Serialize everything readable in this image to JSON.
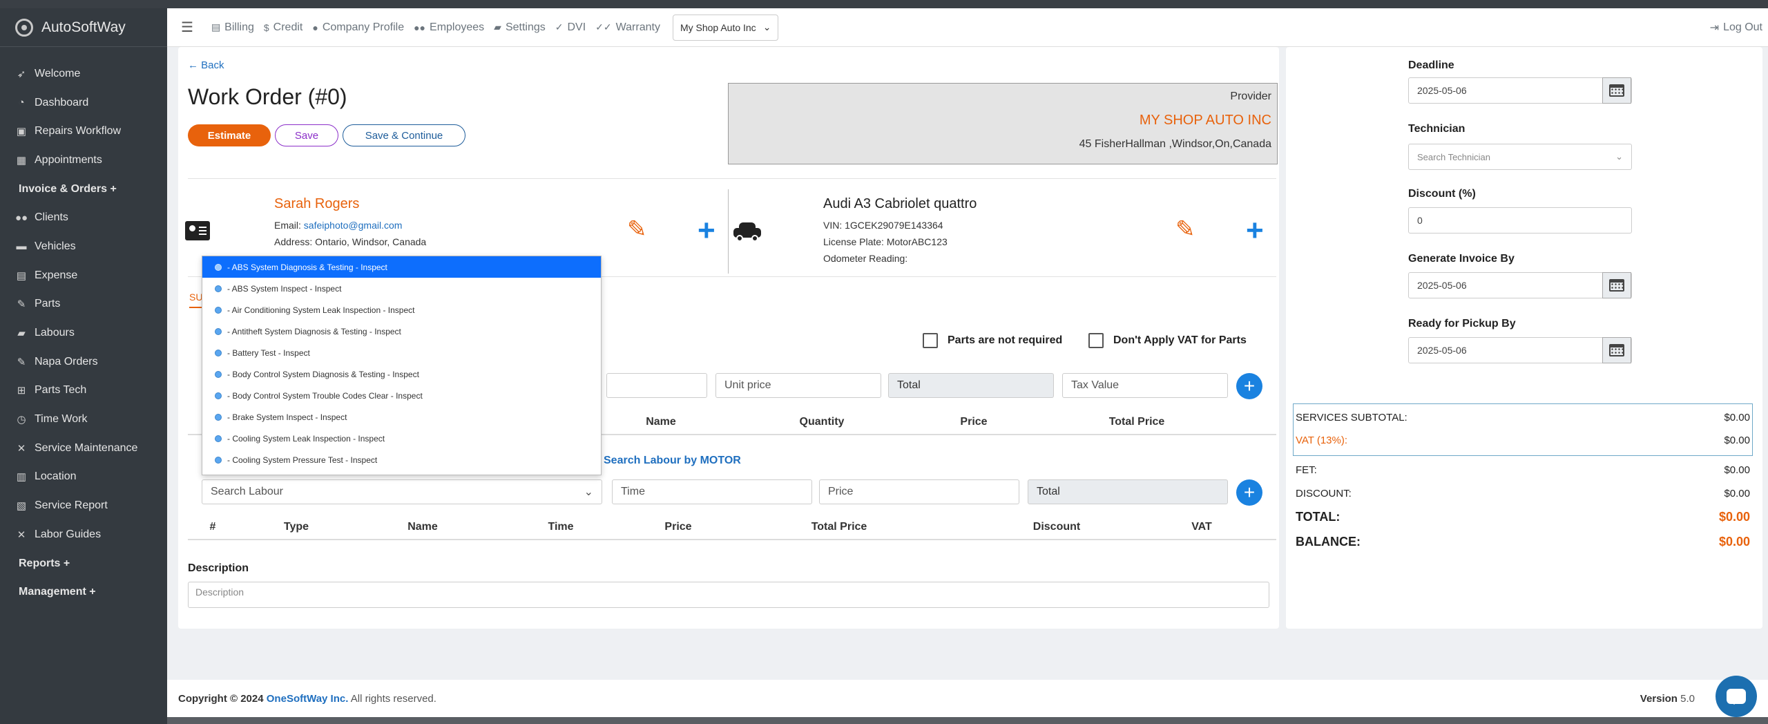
{
  "app": {
    "name": "AutoSoftWay"
  },
  "sidebar": {
    "items": [
      {
        "label": "Welcome",
        "icon": "rocket-icon"
      },
      {
        "label": "Dashboard",
        "icon": "dashboard-icon"
      },
      {
        "label": "Repairs Workflow",
        "icon": "workflow-icon"
      },
      {
        "label": "Appointments",
        "icon": "calendar-icon"
      },
      {
        "label": "Invoice & Orders +",
        "icon": ""
      },
      {
        "label": "Clients",
        "icon": "users-icon"
      },
      {
        "label": "Vehicles",
        "icon": "car-icon"
      },
      {
        "label": "Expense",
        "icon": "money-icon"
      },
      {
        "label": "Parts",
        "icon": "wrench-icon"
      },
      {
        "label": "Labours",
        "icon": "briefcase-icon"
      },
      {
        "label": "Napa Orders",
        "icon": "wrench-icon"
      },
      {
        "label": "Parts Tech",
        "icon": "sitemap-icon"
      },
      {
        "label": "Time Work",
        "icon": "clock-icon"
      },
      {
        "label": "Service Maintenance",
        "icon": "tools-icon"
      },
      {
        "label": "Location",
        "icon": "map-icon"
      },
      {
        "label": "Service Report",
        "icon": "report-icon"
      },
      {
        "label": "Labor Guides",
        "icon": "tools-icon"
      },
      {
        "label": "Reports +",
        "icon": ""
      },
      {
        "label": "Management +",
        "icon": ""
      }
    ]
  },
  "topbar": {
    "items": [
      {
        "label": "Billing",
        "icon": "billing-icon"
      },
      {
        "label": "Credit",
        "icon": "dollar-icon"
      },
      {
        "label": "Company Profile",
        "icon": "user-icon"
      },
      {
        "label": "Employees",
        "icon": "users-icon"
      },
      {
        "label": "Settings",
        "icon": "briefcase-icon"
      },
      {
        "label": "DVI",
        "icon": "check-icon"
      },
      {
        "label": "Warranty",
        "icon": "check-double-icon"
      }
    ],
    "shop_select": "My Shop Auto Inc",
    "logout": "Log Out"
  },
  "work_order": {
    "back": "Back",
    "title": "Work Order (#0)",
    "estimate_btn": "Estimate",
    "save_btn": "Save",
    "save_continue_btn": "Save & Continue",
    "provider": {
      "label": "Provider",
      "name": "MY SHOP AUTO INC",
      "address": "45 FisherHallman ,Windsor,On,Canada"
    },
    "client": {
      "name": "Sarah Rogers",
      "email_label": "Email:",
      "email": "safeiphoto@gmail.com",
      "address": "Address: Ontario, Windsor, Canada"
    },
    "vehicle": {
      "name": "Audi A3 Cabriolet quattro",
      "vin": "VIN: 1GCEK29079E143364",
      "plate": "License Plate: MotorABC123",
      "odometer": "Odometer Reading:"
    },
    "tab_peek": "SU",
    "parts_not_required": "Parts are not required",
    "dont_apply_vat": "Don't Apply VAT for Parts",
    "parts_row": {
      "unit_price": "Unit price",
      "total": "Total",
      "tax_value": "Tax Value"
    },
    "parts_table_headers": [
      "Name",
      "Quantity",
      "Price",
      "Total Price"
    ],
    "search_motor": "Search Labour by MOTOR",
    "labour_row": {
      "search_placeholder": "Search Labour",
      "time": "Time",
      "price": "Price",
      "total": "Total"
    },
    "labour_table_headers": [
      "#",
      "Type",
      "Name",
      "Time",
      "Price",
      "Total Price",
      "Discount",
      "VAT"
    ],
    "description_label": "Description",
    "description_placeholder": "Description"
  },
  "labour_dropdown": {
    "items": [
      "- ABS System Diagnosis & Testing - Inspect",
      "- ABS System Inspect - Inspect",
      "- Air Conditioning System Leak Inspection - Inspect",
      "- Antitheft System Diagnosis & Testing - Inspect",
      "- Battery Test - Inspect",
      "- Body Control System Diagnosis & Testing - Inspect",
      "- Body Control System Trouble Codes Clear - Inspect",
      "- Brake System Inspect - Inspect",
      "- Cooling System Leak Inspection - Inspect",
      "- Cooling System Pressure Test - Inspect"
    ],
    "active_index": 0
  },
  "side_panel": {
    "deadline_label": "Deadline",
    "deadline": "2025-05-06",
    "technician_label": "Technician",
    "technician_placeholder": "Search Technician",
    "discount_label": "Discount (%)",
    "discount": "0",
    "invoice_by_label": "Generate Invoice By",
    "invoice_by": "2025-05-06",
    "pickup_label": "Ready for Pickup By",
    "pickup": "2025-05-06",
    "totals": {
      "services_subtotal_label": "SERVICES SUBTOTAL:",
      "services_subtotal": "$0.00",
      "vat_label": "VAT (13%):",
      "vat": "$0.00",
      "fet_label": "FET:",
      "fet": "$0.00",
      "discount_label": "DISCOUNT:",
      "discount": "$0.00",
      "total_label": "TOTAL:",
      "total": "$0.00",
      "balance_label": "BALANCE:",
      "balance": "$0.00"
    }
  },
  "footer": {
    "copyright": "Copyright © 2024",
    "company": "OneSoftWay Inc.",
    "rights": "All rights reserved.",
    "version_label": "Version",
    "version": "5.0"
  },
  "colors": {
    "accent_orange": "#e8620c",
    "link_blue": "#1f6fbf",
    "sidebar_bg": "#343a40",
    "plus_blue": "#1a82e0"
  }
}
